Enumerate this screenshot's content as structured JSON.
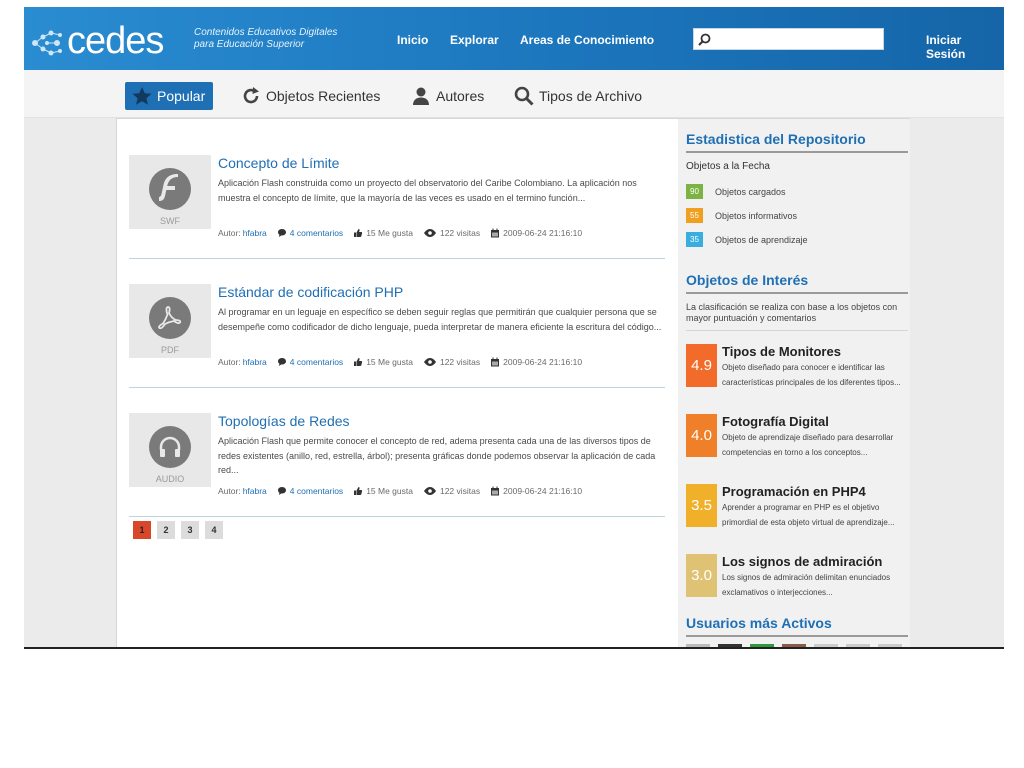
{
  "header": {
    "logo_text": "cedes",
    "tagline_line1": "Contenidos Educativos Digitales",
    "tagline_line2": "para Educación Superior",
    "nav": [
      "Inicio",
      "Explorar",
      "Areas de Conocimiento"
    ],
    "search_placeholder": "",
    "login": "Iniciar Sesión"
  },
  "tabs": [
    {
      "label": "Popular",
      "icon": "star-icon",
      "active": true
    },
    {
      "label": "Objetos Recientes",
      "icon": "refresh-icon",
      "active": false
    },
    {
      "label": "Autores",
      "icon": "user-icon",
      "active": false
    },
    {
      "label": "Tipos de Archivo",
      "icon": "search-icon",
      "active": false
    }
  ],
  "items": [
    {
      "title": "Concepto de Límite",
      "type_label": "SWF",
      "icon": "flash-icon",
      "description": "Aplicación Flash construida como un proyecto del observatorio del Caribe Colombiano. La aplicación nos muestra el concepto de límite, que la mayoría de las veces es usado en el termino función...",
      "author_label": "Autor:",
      "author": "hfabra",
      "comments": "4 comentarios",
      "likes": "15 Me gusta",
      "visits": "122 visitas",
      "date": "2009-06-24 21:16:10"
    },
    {
      "title": "Estándar de codificación PHP",
      "type_label": "PDF",
      "icon": "pdf-icon",
      "description": "Al programar en un leguaje en específico se deben seguir reglas que permitirán que cualquier persona que se desempeñe como codificador de dicho lenguaje, pueda interpretar de manera eficiente la escritura del código...",
      "author_label": "Autor:",
      "author": "hfabra",
      "comments": "4 comentarios",
      "likes": "15 Me gusta",
      "visits": "122 visitas",
      "date": "2009-06-24 21:16:10"
    },
    {
      "title": "Topologías de Redes",
      "type_label": "AUDIO",
      "icon": "headphones-icon",
      "description": "Aplicación Flash que permite conocer el concepto de red, adema presenta cada una de las diversos tipos de redes existentes (anillo, red, estrella, árbol); presenta gráficas donde podemos observar la aplicación de cada red...",
      "author_label": "Autor:",
      "author": "hfabra",
      "comments": "4 comentarios",
      "likes": "15 Me gusta",
      "visits": "122 visitas",
      "date": "2009-06-24 21:16:10"
    }
  ],
  "pagination": {
    "pages": [
      "1",
      "2",
      "3",
      "4"
    ],
    "current": "1"
  },
  "sidebar": {
    "stats_title": "Estadistica del Repositorio",
    "stats_subtitle": "Objetos a la Fecha",
    "stats": [
      {
        "count": "90",
        "label": "Objetos cargados",
        "color": "#7cb342"
      },
      {
        "count": "55",
        "label": "Objetos informativos",
        "color": "#f0a020"
      },
      {
        "count": "35",
        "label": "Objetos de aprendizaje",
        "color": "#38aee0"
      }
    ],
    "interest_title": "Objetos de Interés",
    "interest_note": "La clasificación se realiza con base a los objetos con mayor puntuación y comentarios",
    "objects": [
      {
        "score": "4.9",
        "title": "Tipos de Monitores",
        "desc": "Objeto diseñado para conocer e identificar las características principales de los diferentes tipos...",
        "color": "#f26b2a"
      },
      {
        "score": "4.0",
        "title": "Fotografía Digital",
        "desc": "Objeto de aprendizaje diseñado para desarrollar competencias en torno a los conceptos...",
        "color": "#f07f2a"
      },
      {
        "score": "3.5",
        "title": "Programación en PHP4",
        "desc": "Aprender a programar en PHP es el objetivo primordial de esta objeto virtual de aprendizaje...",
        "color": "#f1b02a"
      },
      {
        "score": "3.0",
        "title": "Los signos de admiración",
        "desc": "Los signos de admiración delimitan enunciados exclamativos o interjecciones...",
        "color": "#e0c274"
      }
    ],
    "users_title": "Usuarios más Activos"
  }
}
